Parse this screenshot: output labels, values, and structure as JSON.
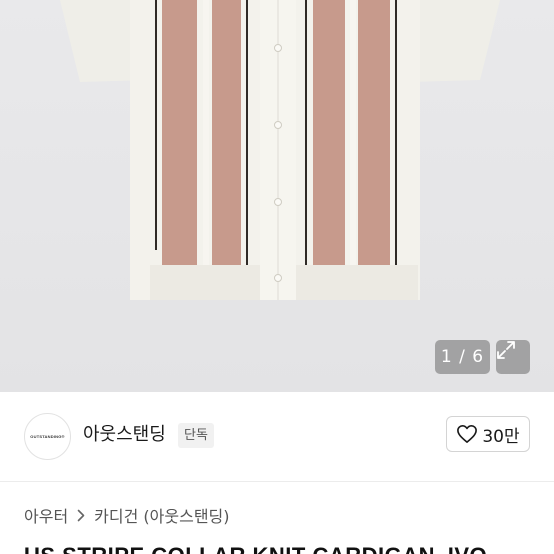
{
  "gallery": {
    "counter": "1 / 6",
    "current": 1,
    "total": 6
  },
  "icons": {
    "expand": "expand-icon",
    "heart": "heart-icon",
    "chevron": "chevron-right-icon"
  },
  "seller": {
    "logo_text": "OUTSTANDING®",
    "name": "아웃스탠딩",
    "badge": "단독"
  },
  "like": {
    "count": "30만"
  },
  "breadcrumb": {
    "category": "아우터",
    "subcategory": "카디건 (아웃스탠딩)"
  },
  "product": {
    "title": "US STRIPE COLLAR KNIT CARDIGAN_IVO"
  },
  "colors": {
    "stripe_pink": "#c79a8c",
    "knit_ivory": "#f3f2ec",
    "stripe_dark": "#2f2a26"
  }
}
